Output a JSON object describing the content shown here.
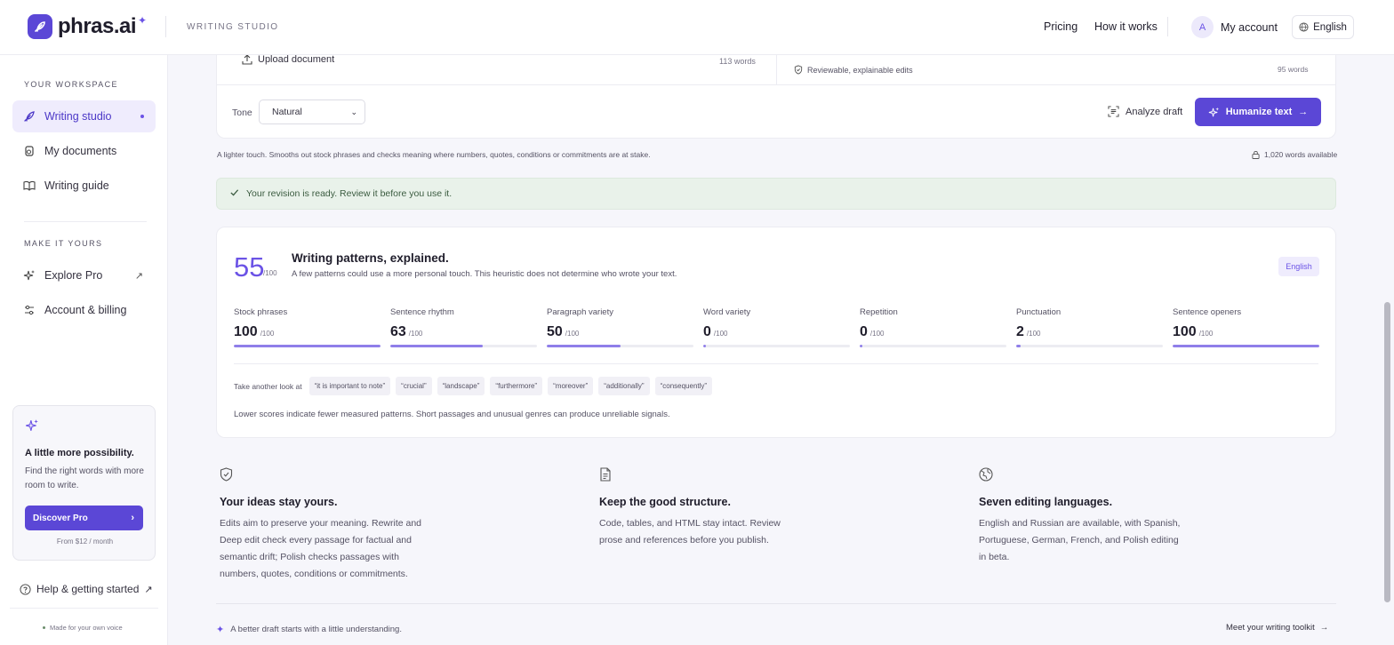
{
  "brand": {
    "name": "phras.ai",
    "section": "WRITING STUDIO"
  },
  "topnav": {
    "pricing": "Pricing",
    "how": "How it works",
    "avatar_initial": "A",
    "account": "My account",
    "language": "English"
  },
  "sidebar": {
    "workspace_heading": "YOUR WORKSPACE",
    "items": [
      {
        "label": "Writing studio",
        "icon": "feather-icon",
        "active": true
      },
      {
        "label": "My documents",
        "icon": "documents-icon"
      },
      {
        "label": "Writing guide",
        "icon": "book-icon"
      }
    ],
    "make_heading": "MAKE IT YOURS",
    "items2": [
      {
        "label": "Explore Pro",
        "icon": "sparkles-icon"
      },
      {
        "label": "Account & billing",
        "icon": "sliders-icon"
      }
    ],
    "promo": {
      "title": "A little more possibility.",
      "body": "Find the right words with more room to write.",
      "button": "Discover Pro",
      "price": "From $12 / month"
    },
    "help": "Help & getting started",
    "footer": "Made for your own voice"
  },
  "editor": {
    "upload": "Upload document",
    "words_left": "113 words",
    "reviewable": "Reviewable, explainable edits",
    "words_right": "95 words",
    "tone_label": "Tone",
    "tone_value": "Natural",
    "analyze": "Analyze draft",
    "humanize": "Humanize text",
    "tone_desc": "A lighter touch. Smooths out stock phrases and checks meaning where numbers, quotes, conditions or commitments are at stake.",
    "words_available": "1,020 words available"
  },
  "ready": {
    "message": "Your revision is ready. Review it before you use it."
  },
  "patterns": {
    "score": "55",
    "score_max": "/100",
    "title": "Writing patterns, explained.",
    "subtitle": "A few patterns could use a more personal touch. This heuristic does not determine who wrote your text.",
    "language": "English",
    "metrics": [
      {
        "name": "Stock phrases",
        "value": 100,
        "max": "/100"
      },
      {
        "name": "Sentence rhythm",
        "value": 63,
        "max": "/100"
      },
      {
        "name": "Paragraph variety",
        "value": 50,
        "max": "/100"
      },
      {
        "name": "Word variety",
        "value": 0,
        "max": "/100"
      },
      {
        "name": "Repetition",
        "value": 0,
        "max": "/100"
      },
      {
        "name": "Punctuation",
        "value": 2,
        "max": "/100"
      },
      {
        "name": "Sentence openers",
        "value": 100,
        "max": "/100"
      }
    ],
    "another_look": "Take another look at",
    "chips": [
      "“it is important to note”",
      "“crucial”",
      "“landscape”",
      "“furthermore”",
      "“moreover”",
      "“additionally”",
      "“consequently”"
    ],
    "note": "Lower scores indicate fewer measured patterns. Short passages and unusual genres can produce unreliable signals."
  },
  "features": [
    {
      "icon": "shield-check-icon",
      "title": "Your ideas stay yours.",
      "body": "Edits aim to preserve your meaning. Rewrite and Deep edit check every passage for factual and semantic drift; Polish checks passages with numbers, quotes, conditions or commitments."
    },
    {
      "icon": "document-icon",
      "title": "Keep the good structure.",
      "body": "Code, tables, and HTML stay intact. Review prose and references before you publish."
    },
    {
      "icon": "globe-icon",
      "title": "Seven editing languages.",
      "body": "English and Russian are available, with Spanish, Portuguese, German, French, and Polish editing in beta."
    }
  ],
  "footer": {
    "left": "A better draft starts with a little understanding.",
    "right": "Meet your writing toolkit"
  }
}
